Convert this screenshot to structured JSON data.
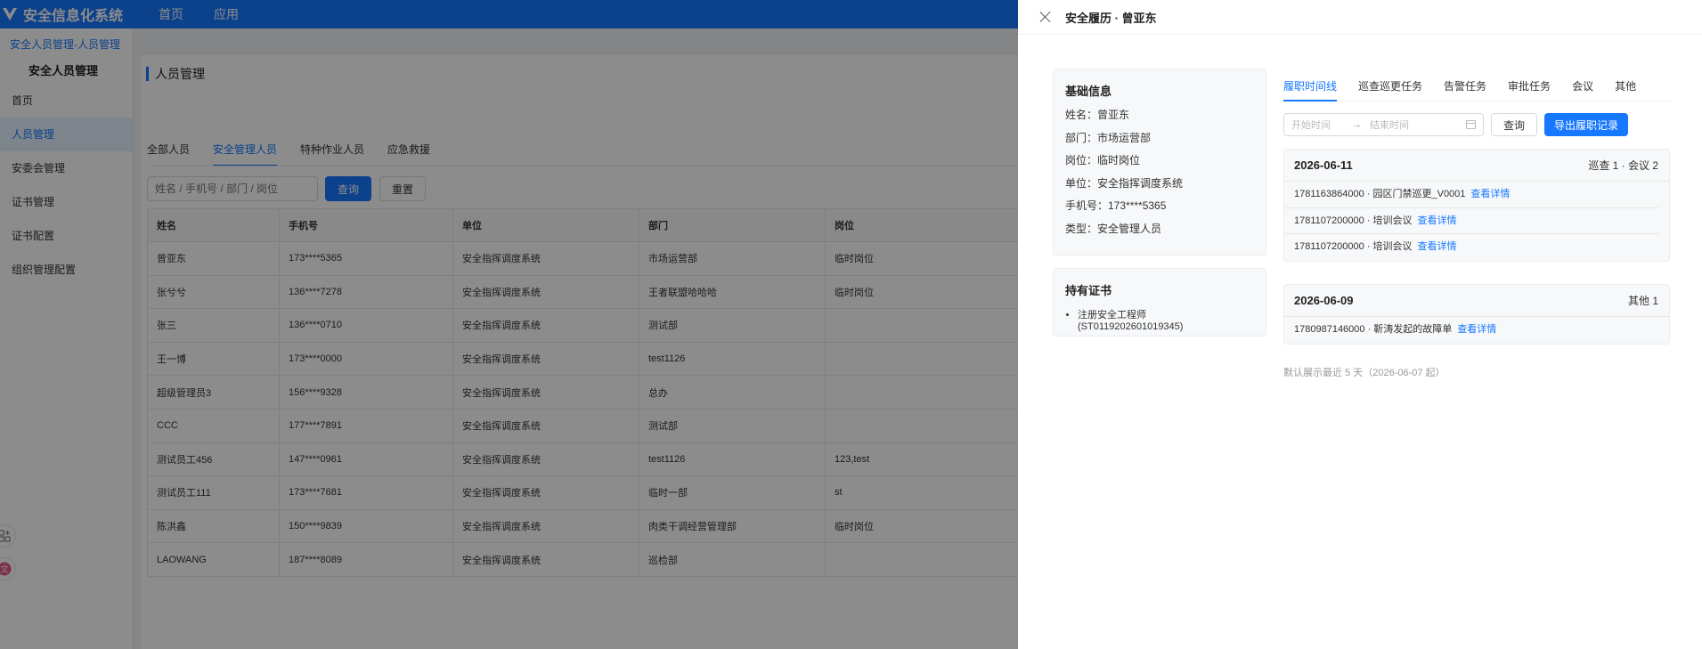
{
  "app": {
    "name": "安全信息化系统",
    "nav": [
      "首页",
      "应用"
    ]
  },
  "sidebar": {
    "breadcrumb": "安全人员管理-人员管理",
    "title": "安全人员管理",
    "items": [
      "首页",
      "人员管理",
      "安委会管理",
      "证书管理",
      "证书配置",
      "组织管理配置"
    ],
    "active_index": 1
  },
  "page": {
    "title": "人员管理",
    "tabs": [
      "全部人员",
      "安全管理人员",
      "特种作业人员",
      "应急救援"
    ],
    "active_tab": 1,
    "search_placeholder": "姓名 / 手机号 / 部门 / 岗位",
    "search_button": "查询",
    "reset_button": "重置"
  },
  "table": {
    "columns": [
      "姓名",
      "手机号",
      "单位",
      "部门",
      "岗位"
    ],
    "rows": [
      [
        "曾亚东",
        "173****5365",
        "安全指挥调度系统",
        "市场运营部",
        "临时岗位"
      ],
      [
        "张兮兮",
        "136****7278",
        "安全指挥调度系统",
        "王者联盟哈哈哈",
        "临时岗位"
      ],
      [
        "张三",
        "136****0710",
        "安全指挥调度系统",
        "测试部",
        ""
      ],
      [
        "王一博",
        "173****0000",
        "安全指挥调度系统",
        "test1126",
        ""
      ],
      [
        "超级管理员3",
        "156****9328",
        "安全指挥调度系统",
        "总办",
        ""
      ],
      [
        "CCC",
        "177****7891",
        "安全指挥调度系统",
        "测试部",
        ""
      ],
      [
        "测试员工456",
        "147****0961",
        "安全指挥调度系统",
        "test1126",
        "123,test"
      ],
      [
        "测试员工111",
        "173****7681",
        "安全指挥调度系统",
        "临时一部",
        "st"
      ],
      [
        "陈洪鑫",
        "150****9839",
        "安全指挥调度系统",
        "肉类干调经营管理部",
        "临时岗位"
      ],
      [
        "LAOWANG",
        "187****8089",
        "安全指挥调度系统",
        "巡检部",
        ""
      ]
    ]
  },
  "drawer": {
    "title": "安全履历 · 曾亚东",
    "basic_title": "基础信息",
    "basic": [
      "姓名：曾亚东",
      "部门：市场运营部",
      "岗位：临时岗位",
      "单位：安全指挥调度系统",
      "手机号：173****5365",
      "类型：安全管理人员"
    ],
    "cert_title": "持有证书",
    "certs": [
      "注册安全工程师 (ST0119202601019345)"
    ],
    "tabs": [
      "履职时间线",
      "巡查巡更任务",
      "告警任务",
      "审批任务",
      "会议",
      "其他"
    ],
    "active_tab": 0,
    "start_placeholder": "开始时间",
    "end_placeholder": "结束时间",
    "range_arrow": "→",
    "query_button": "查询",
    "export_button": "导出履职记录",
    "days": [
      {
        "date": "2026-06-11",
        "summary": "巡查 1 · 会议 2",
        "items": [
          {
            "text": "1781163864000 · 园区门禁巡更_V0001",
            "link": "查看详情"
          },
          {
            "text": "1781107200000 · 培训会议",
            "link": "查看详情"
          },
          {
            "text": "1781107200000 · 培训会议",
            "link": "查看详情"
          }
        ]
      },
      {
        "date": "2026-06-09",
        "summary": "其他 1",
        "items": [
          {
            "text": "1780987146000 · 靳涛发起的故障单",
            "link": "查看详情"
          }
        ]
      }
    ],
    "footnote": "默认展示最近 5 天（2026-06-07 起）"
  },
  "colors": {
    "primary": "#1677ff",
    "mask": "rgba(0,0,0,0.45)"
  }
}
